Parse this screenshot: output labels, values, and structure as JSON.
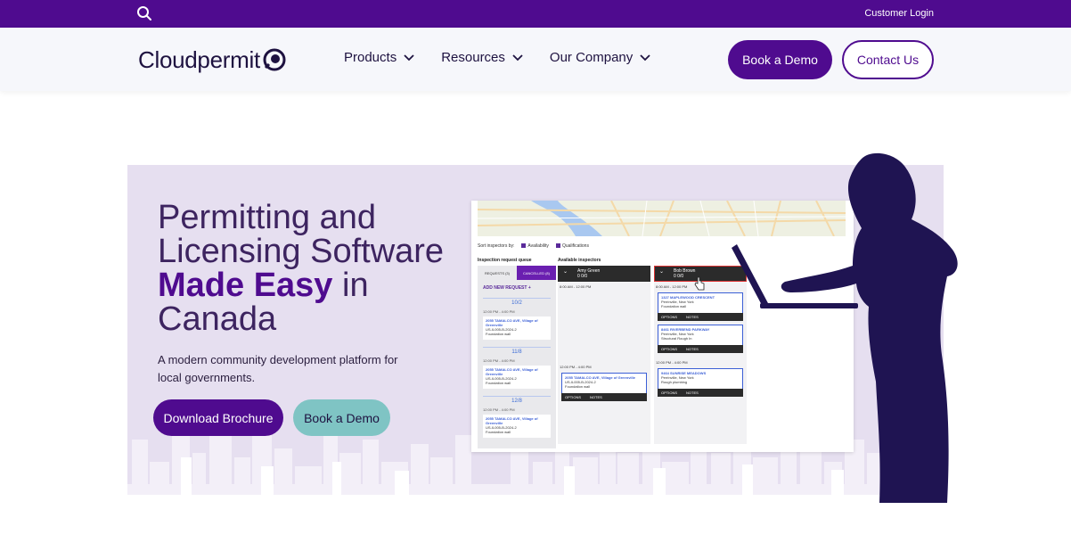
{
  "topbar": {
    "customer_login": "Customer Login"
  },
  "header": {
    "logo": "Cloudpermit",
    "nav": [
      {
        "label": "Products"
      },
      {
        "label": "Resources"
      },
      {
        "label": "Our Company"
      }
    ],
    "book_demo": "Book a Demo",
    "contact": "Contact Us"
  },
  "hero": {
    "headline_line1": "Permitting and",
    "headline_line2": "Licensing Software",
    "headline_strong": "Made Easy",
    "headline_in": " in",
    "headline_line4": "Canada",
    "subtext": "A modern community development platform for local governments.",
    "download_brochure": "Download Brochure",
    "book_demo": "Book a Demo"
  },
  "app_preview": {
    "sort_by": "Sort inspectors by:",
    "availability": "Availability",
    "qualifications": "Qualifications",
    "queue_title": "Inspection request queue",
    "available_title": "Available inspectors",
    "tab_requests": "REQUESTS (3)",
    "tab_cancelled": "CANCELLED (8)",
    "add_request": "ADD NEW REQUEST  +",
    "queue": [
      {
        "date": "10/2",
        "time": "12:00 PM - 4:00 PM",
        "addr": "2055 TAMALCO AVE, Village of Greenville",
        "id": "US-IL005-B-2024-2",
        "type": "Foundation wall"
      },
      {
        "date": "11/8",
        "time": "12:00 PM - 4:00 PM",
        "addr": "2055 TAMALCO AVE, Village of Greenville",
        "id": "US-IL005-B-2024-2",
        "type": "Foundation wall"
      },
      {
        "date": "12/8",
        "time": "12:00 PM - 4:00 PM",
        "addr": "2055 TAMALCO AVE, Village of Greenville",
        "id": "US-IL005-B-2024-2",
        "type": "Foundation wall"
      }
    ],
    "inspector1": {
      "name": "Amy Green",
      "count": "0 0/0",
      "time1": "8:00 AM - 12:00 PM",
      "time2": "12:00 PM - 4:00 PM",
      "card": {
        "addr": "2055 TAMALCO AVE, Village of Greenville",
        "id": "US-IL005-B-2024-2",
        "type": "Foundation wall"
      }
    },
    "inspector2": {
      "name": "Bob Brown",
      "count": "0 0/0",
      "time1": "8:00 AM - 12:00 PM",
      "time2": "12:00 PM - 4:00 PM",
      "cards": [
        {
          "addr": "1327 MAPLEWOOD CRESCENT",
          "city": "Perrinville, New York",
          "type": "Foundation wall"
        },
        {
          "addr": "8461 RIVERBEND PARKWAY",
          "city": "Perrinville, New York",
          "type": "Structural Rough In"
        },
        {
          "addr": "9464 SUNRISE MEADOWS",
          "city": "Perrinville, New York",
          "type": "Rough plumbing"
        }
      ]
    },
    "options": "OPTIONS",
    "notes": "NOTES"
  },
  "colors": {
    "brand": "#4f0b8f",
    "teal": "#7fc4c4",
    "hero_bg": "#e6dff0",
    "silhouette": "#1f1452"
  }
}
